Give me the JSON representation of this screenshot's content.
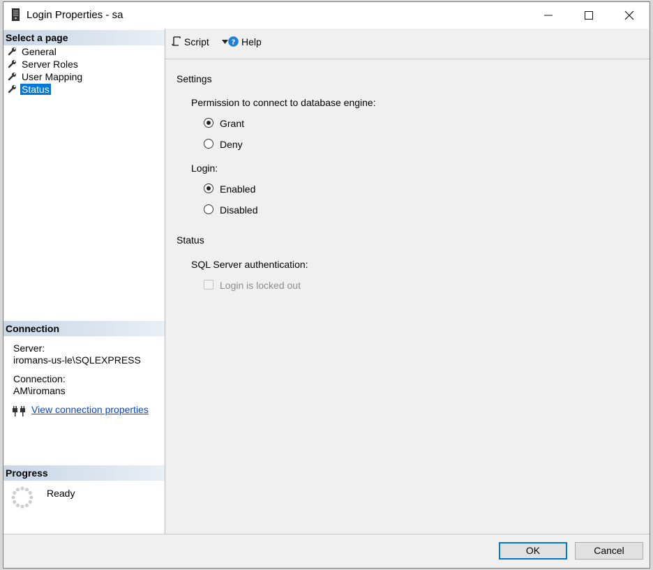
{
  "window": {
    "title": "Login Properties - sa"
  },
  "select_page": {
    "header": "Select a page",
    "items": [
      {
        "label": "General",
        "selected": false
      },
      {
        "label": "Server Roles",
        "selected": false
      },
      {
        "label": "User Mapping",
        "selected": false
      },
      {
        "label": "Status",
        "selected": true
      }
    ]
  },
  "connection": {
    "header": "Connection",
    "server_label": "Server:",
    "server_value": "iromans-us-le\\SQLEXPRESS",
    "connection_label": "Connection:",
    "connection_value": "AM\\iromans",
    "link_label": "View connection properties"
  },
  "progress": {
    "header": "Progress",
    "status": "Ready"
  },
  "toolbar": {
    "script_label": "Script",
    "help_label": "Help"
  },
  "settings": {
    "title": "Settings",
    "permission_label": "Permission to connect to database engine:",
    "grant_label": "Grant",
    "deny_label": "Deny",
    "permission_value": "Grant",
    "login_label": "Login:",
    "enabled_label": "Enabled",
    "disabled_label": "Disabled",
    "login_value": "Enabled"
  },
  "status": {
    "title": "Status",
    "auth_label": "SQL Server authentication:",
    "locked_out_label": "Login is locked out",
    "locked_out_checked": false,
    "locked_out_enabled": false
  },
  "buttons": {
    "ok_label": "OK",
    "cancel_label": "Cancel"
  },
  "colors": {
    "selection": "#0078d7",
    "link": "#0645d6",
    "header_gradient": "#c8d6e6"
  }
}
